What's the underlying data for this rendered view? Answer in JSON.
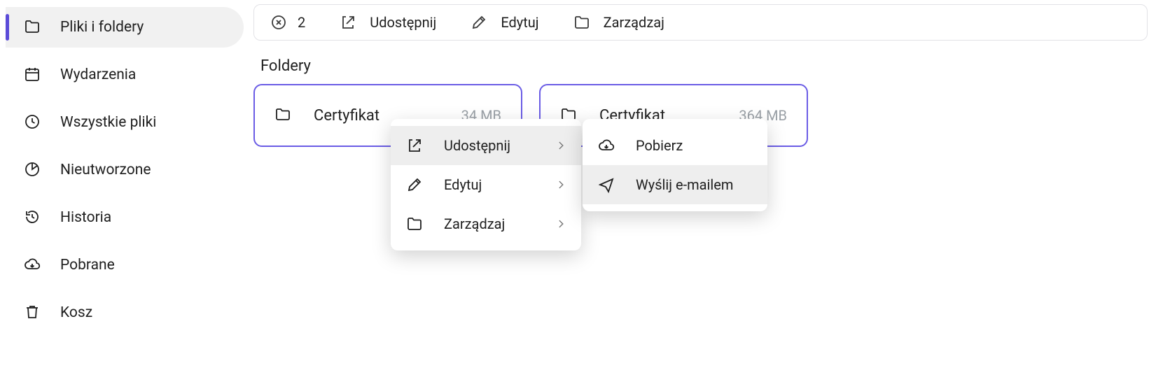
{
  "sidebar": {
    "items": [
      {
        "label": "Pliki i foldery",
        "icon": "folder-open-icon",
        "active": true
      },
      {
        "label": "Wydarzenia",
        "icon": "calendar-icon",
        "active": false
      },
      {
        "label": "Wszystkie pliki",
        "icon": "clock-icon",
        "active": false
      },
      {
        "label": "Nieutworzone",
        "icon": "pie-icon",
        "active": false
      },
      {
        "label": "Historia",
        "icon": "history-icon",
        "active": false
      },
      {
        "label": "Pobrane",
        "icon": "download-cloud-icon",
        "active": false
      },
      {
        "label": "Kosz",
        "icon": "trash-icon",
        "active": false
      }
    ]
  },
  "topbar": {
    "selected_count": "2",
    "actions": [
      {
        "label": "Udostępnij",
        "icon": "share-icon"
      },
      {
        "label": "Edytuj",
        "icon": "pencil-icon"
      },
      {
        "label": "Zarządzaj",
        "icon": "folder-open-icon"
      }
    ]
  },
  "section_title": "Foldery",
  "folders": [
    {
      "name": "Certyfikat",
      "size": "34 MB"
    },
    {
      "name": "Certyfikat",
      "size": "364 MB"
    }
  ],
  "context_menu": {
    "items": [
      {
        "label": "Udostępnij",
        "icon": "share-icon",
        "has_sub": true,
        "highlight": true
      },
      {
        "label": "Edytuj",
        "icon": "pencil-icon",
        "has_sub": true,
        "highlight": false
      },
      {
        "label": "Zarządzaj",
        "icon": "folder-open-icon",
        "has_sub": true,
        "highlight": false
      }
    ],
    "submenu": [
      {
        "label": "Pobierz",
        "icon": "download-cloud-icon",
        "highlight": false
      },
      {
        "label": "Wyślij e-mailem",
        "icon": "send-icon",
        "highlight": true
      }
    ]
  }
}
